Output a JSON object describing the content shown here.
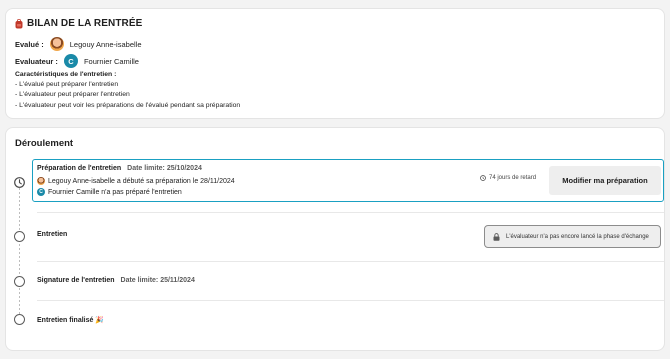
{
  "info": {
    "title": "BILAN DE LA RENTRÉE",
    "evalue_label": "Evalué :",
    "evalue_name": "Legouy Anne-isabelle",
    "evaluateur_label": "Evaluateur :",
    "evaluateur_initial": "C",
    "evaluateur_name": "Fournier Camille",
    "characteristics_title": "Caractéristiques de l'entretien :",
    "characteristics": [
      "- L'évalué peut préparer l'entretien",
      "- L'évaluateur peut préparer l'entretien",
      "- L'évaluateur peut voir les préparations de l'évalué pendant sa préparation"
    ]
  },
  "flow": {
    "title": "Déroulement",
    "steps": [
      {
        "name": "Préparation de l'entretien",
        "date": "Date limite: 25/10/2024",
        "status_evalue": "Legouy Anne-isabelle a débuté sa préparation le 28/11/2024",
        "status_evaluateur": "Fournier Camille n'a pas préparé l'entretien",
        "evaluateur_initial": "C",
        "delay": "74 jours de retard",
        "action_label": "Modifier ma préparation"
      },
      {
        "name": "Entretien",
        "locked_text": "L'évaluateur n'a pas encore lancé la phase d'échange"
      },
      {
        "name": "Signature de l'entretien",
        "date": "Date limite: 25/11/2024"
      },
      {
        "name": "Entretien finalisé 🎉"
      }
    ]
  },
  "colors": {
    "accent": "#1aa0c2",
    "avatar_bg": "#1a8aa8",
    "bag_icon": "#c0392b"
  },
  "icons": {
    "title": "backpack-icon",
    "current_step": "clock-icon",
    "delay": "clock-small-icon",
    "locked": "lock-icon"
  }
}
